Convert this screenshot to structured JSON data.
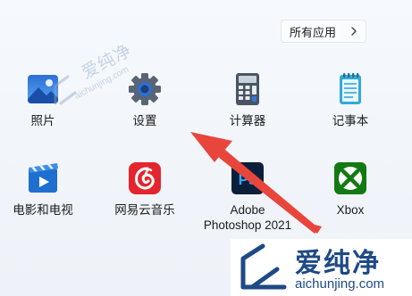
{
  "header": {
    "all_apps_label": "所有应用"
  },
  "pinned_apps": [
    {
      "label": "照片",
      "icon": "photos-icon"
    },
    {
      "label": "设置",
      "icon": "settings-gear-icon"
    },
    {
      "label": "计算器",
      "icon": "calculator-icon"
    },
    {
      "label": "记事本",
      "icon": "notepad-icon"
    },
    {
      "label": "电影和电视",
      "icon": "movies-tv-icon"
    },
    {
      "label": "网易云音乐",
      "icon": "netease-music-icon"
    },
    {
      "label_line1": "Adobe",
      "label_line2": "Photoshop 2021",
      "icon": "photoshop-icon",
      "icon_text": "Ps"
    },
    {
      "label": "Xbox",
      "icon": "xbox-icon"
    }
  ],
  "watermark": {
    "name": "爱纯净",
    "url": "aichunjing.com"
  },
  "colors": {
    "arrow": "#e8463c",
    "watermark": "#1e4a86"
  }
}
